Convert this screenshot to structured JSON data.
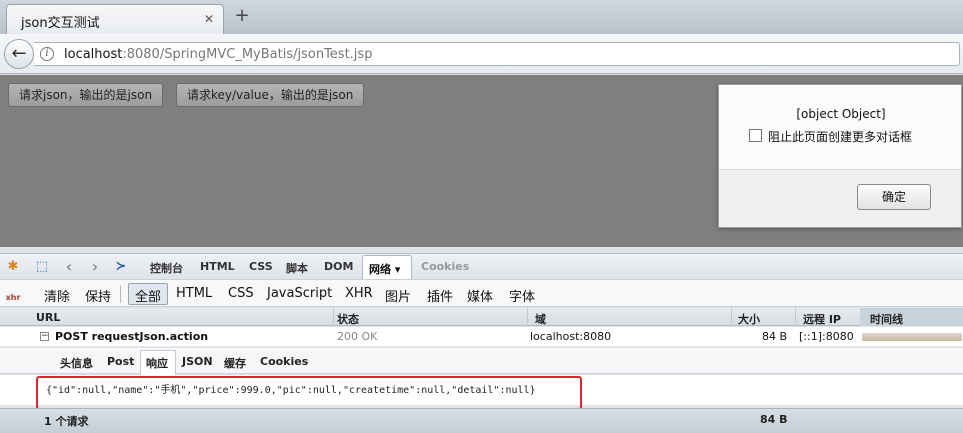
{
  "browser": {
    "tab_title": "json交互测试",
    "tab_close": "✕",
    "new_tab": "+",
    "url_host": "localhost",
    "url_rest": ":8080/SpringMVC_MyBatis/jsonTest.jsp"
  },
  "page": {
    "buttons": [
      "请求json，输出的是json",
      "请求key/value，输出的是json"
    ]
  },
  "dialog": {
    "message": "[object Object]",
    "checkbox_label": "阻止此页面创建更多对话框",
    "ok_label": "确定"
  },
  "firebug": {
    "tabs": [
      "控制台",
      "HTML",
      "CSS",
      "脚本",
      "DOM"
    ],
    "active_tab": "网络 ▾",
    "disabled_tab": "Cookies",
    "toolbar": [
      "清除",
      "保持"
    ],
    "filters": [
      "全部",
      "HTML",
      "CSS",
      "JavaScript",
      "XHR",
      "图片",
      "插件",
      "媒体",
      "字体"
    ],
    "columns": {
      "url": "URL",
      "status": "状态",
      "domain": "域",
      "size": "大小",
      "remote_ip": "远程 IP",
      "timeline": "时间线"
    },
    "request": {
      "method_url": "POST requestJson.action",
      "status": "200 OK",
      "domain": "localhost:8080",
      "size": "84 B",
      "remote_ip": "[::1]:8080"
    },
    "detail_tabs": [
      "头信息",
      "Post",
      "响应",
      "JSON",
      "缓存",
      "Cookies"
    ],
    "response_body": "{\"id\":null,\"name\":\"手机\",\"price\":999.0,\"pic\":null,\"createtime\":null,\"detail\":null}",
    "summary": {
      "count": "1 个请求",
      "total_size": "84 B"
    }
  },
  "colors": {
    "highlight": "#e0262b",
    "page_bg": "#7f7f7f"
  }
}
